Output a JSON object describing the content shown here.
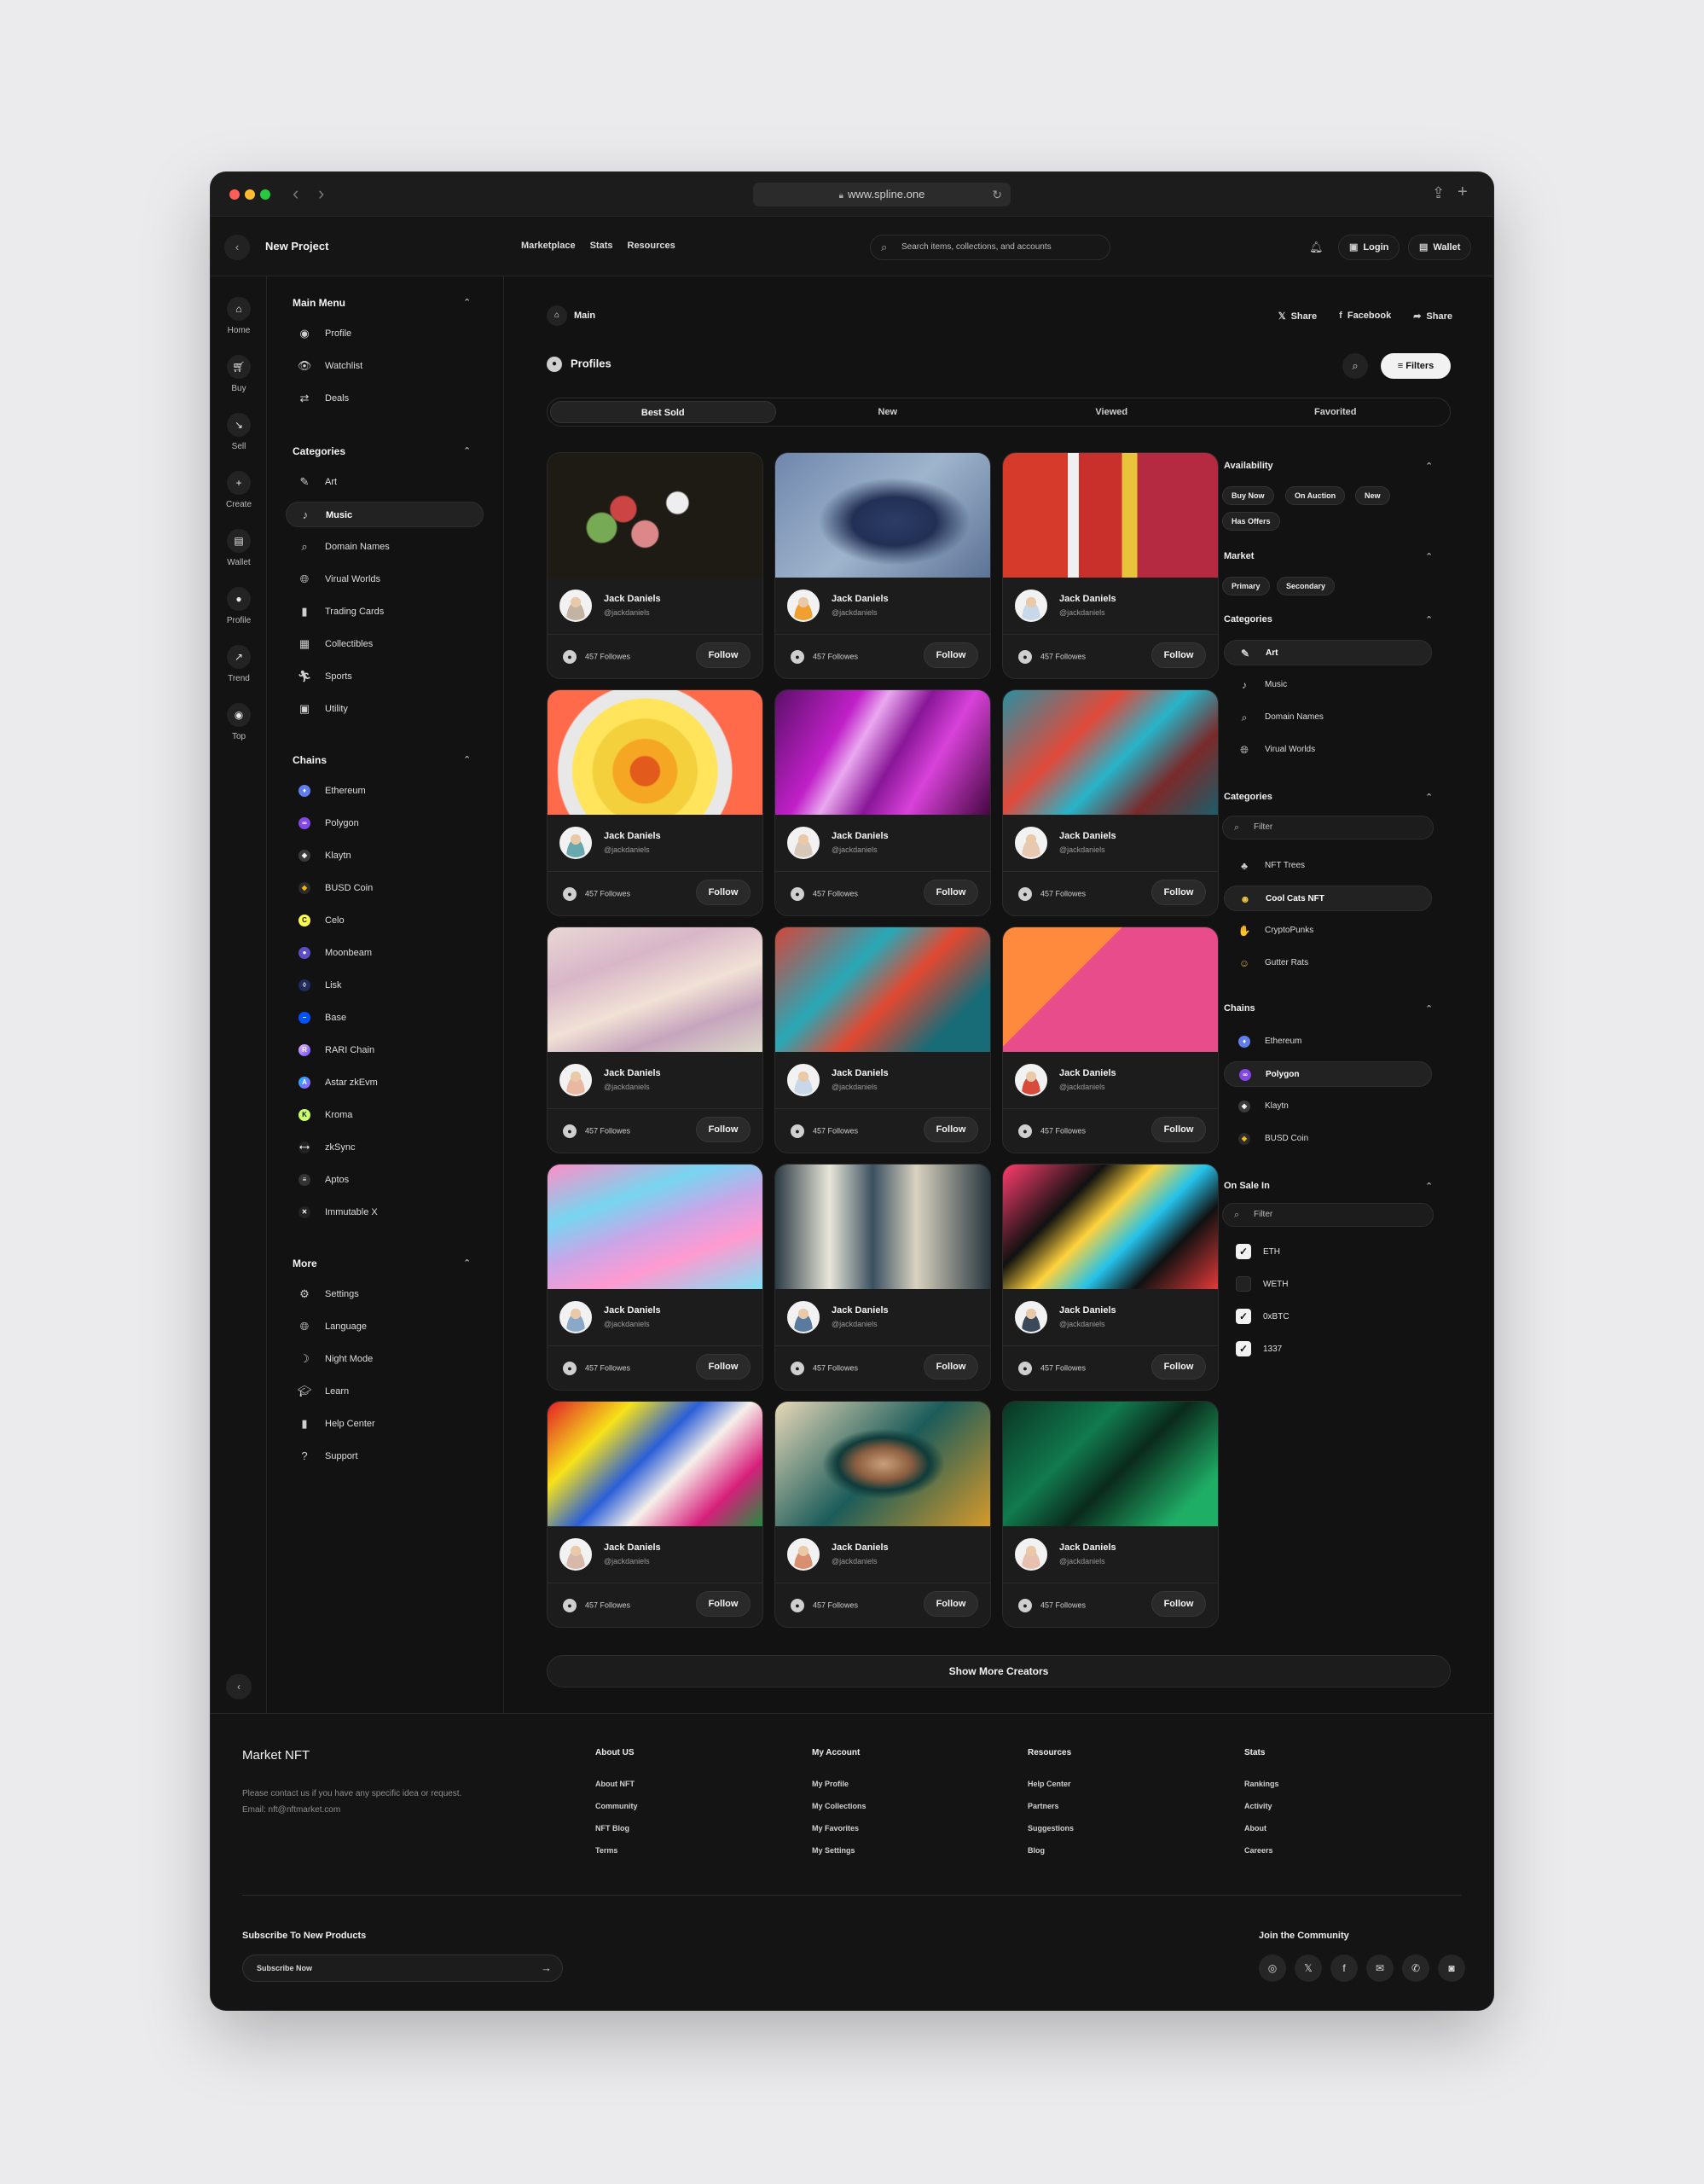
{
  "browser": {
    "url": "www.spline.one"
  },
  "header": {
    "title": "New Project",
    "nav": [
      "Marketplace",
      "Stats",
      "Resources"
    ],
    "search_placeholder": "Search items, collections, and accounts",
    "login_label": "Login",
    "wallet_label": "Wallet"
  },
  "rail": [
    {
      "label": "Home",
      "icon": "home-icon"
    },
    {
      "label": "Buy",
      "icon": "cart-icon"
    },
    {
      "label": "Sell",
      "icon": "trend-down-icon"
    },
    {
      "label": "Create",
      "icon": "plus-icon"
    },
    {
      "label": "Wallet",
      "icon": "wallet-icon"
    },
    {
      "label": "Profile",
      "icon": "user-icon"
    },
    {
      "label": "Trend",
      "icon": "trend-up-icon"
    },
    {
      "label": "Top",
      "icon": "target-icon"
    }
  ],
  "sidebar": {
    "main_menu": {
      "title": "Main Menu",
      "items": [
        "Profile",
        "Watchlist",
        "Deals"
      ]
    },
    "categories": {
      "title": "Categories",
      "items": [
        "Art",
        "Music",
        "Domain Names",
        "Virual Worlds",
        "Trading Cards",
        "Collectibles",
        "Sports",
        "Utility"
      ],
      "active": "Music"
    },
    "chains": {
      "title": "Chains",
      "items": [
        "Ethereum",
        "Polygon",
        "Klaytn",
        "BUSD Coin",
        "Celo",
        "Moonbeam",
        "Lisk",
        "Base",
        "RARI Chain",
        "Astar zkEvm",
        "Kroma",
        "zkSync",
        "Aptos",
        "Immutable X"
      ]
    },
    "more": {
      "title": "More",
      "items": [
        "Settings",
        "Language",
        "Night Mode",
        "Learn",
        "Help Center",
        "Support"
      ]
    }
  },
  "main": {
    "breadcrumb": "Main",
    "share_links": [
      "Share",
      "Facebook",
      "Share"
    ],
    "section_title": "Profiles",
    "filters_label": "Filters",
    "tabs": [
      "Best Sold",
      "New",
      "Viewed",
      "Favorited"
    ],
    "active_tab": "Best Sold",
    "cards": [
      {
        "name": "Jack Daniels",
        "handle": "@jackdaniels",
        "followers": "457 Followes",
        "follow": "Follow"
      },
      {
        "name": "Jack Daniels",
        "handle": "@jackdaniels",
        "followers": "457 Followes",
        "follow": "Follow"
      },
      {
        "name": "Jack Daniels",
        "handle": "@jackdaniels",
        "followers": "457 Followes",
        "follow": "Follow"
      },
      {
        "name": "Jack Daniels",
        "handle": "@jackdaniels",
        "followers": "457 Followes",
        "follow": "Follow"
      },
      {
        "name": "Jack Daniels",
        "handle": "@jackdaniels",
        "followers": "457 Followes",
        "follow": "Follow"
      },
      {
        "name": "Jack Daniels",
        "handle": "@jackdaniels",
        "followers": "457 Followes",
        "follow": "Follow"
      },
      {
        "name": "Jack Daniels",
        "handle": "@jackdaniels",
        "followers": "457 Followes",
        "follow": "Follow"
      },
      {
        "name": "Jack Daniels",
        "handle": "@jackdaniels",
        "followers": "457 Followes",
        "follow": "Follow"
      },
      {
        "name": "Jack Daniels",
        "handle": "@jackdaniels",
        "followers": "457 Followes",
        "follow": "Follow"
      },
      {
        "name": "Jack Daniels",
        "handle": "@jackdaniels",
        "followers": "457 Followes",
        "follow": "Follow"
      },
      {
        "name": "Jack Daniels",
        "handle": "@jackdaniels",
        "followers": "457 Followes",
        "follow": "Follow"
      },
      {
        "name": "Jack Daniels",
        "handle": "@jackdaniels",
        "followers": "457 Followes",
        "follow": "Follow"
      },
      {
        "name": "Jack Daniels",
        "handle": "@jackdaniels",
        "followers": "457 Followes",
        "follow": "Follow"
      },
      {
        "name": "Jack Daniels",
        "handle": "@jackdaniels",
        "followers": "457 Followes",
        "follow": "Follow"
      },
      {
        "name": "Jack Daniels",
        "handle": "@jackdaniels",
        "followers": "457 Followes",
        "follow": "Follow"
      }
    ],
    "show_more": "Show More Creators"
  },
  "filters": {
    "availability": {
      "title": "Availability",
      "chips": [
        "Buy Now",
        "On Auction",
        "New",
        "Has Offers"
      ]
    },
    "market": {
      "title": "Market",
      "chips": [
        "Primary",
        "Secondary"
      ]
    },
    "categories": {
      "title": "Categories",
      "items": [
        "Art",
        "Music",
        "Domain Names",
        "Virual Worlds"
      ],
      "active": "Art"
    },
    "collections": {
      "title": "Categories",
      "placeholder": "Filter",
      "items": [
        "NFT Trees",
        "Cool Cats NFT",
        "CryptoPunks",
        "Gutter Rats"
      ],
      "active": "Cool Cats NFT"
    },
    "chains": {
      "title": "Chains",
      "items": [
        "Ethereum",
        "Polygon",
        "Klaytn",
        "BUSD Coin"
      ],
      "active": "Polygon"
    },
    "on_sale": {
      "title": "On Sale In",
      "placeholder": "Filter",
      "items": [
        {
          "label": "ETH",
          "checked": true
        },
        {
          "label": "WETH",
          "checked": false
        },
        {
          "label": "0xBTC",
          "checked": true
        },
        {
          "label": "1337",
          "checked": true
        }
      ]
    }
  },
  "footer": {
    "brand": "Market NFT",
    "desc_line1": "Please contact us if you have any specific idea or request.",
    "desc_line2": "Email: nft@nftmarket.com",
    "columns": [
      {
        "title": "About US",
        "links": [
          "About NFT",
          "Community",
          "NFT Blog",
          "Terms"
        ]
      },
      {
        "title": "My Account",
        "links": [
          "My Profile",
          "My Collections",
          "My Favorites",
          "My Settings"
        ]
      },
      {
        "title": "Resources",
        "links": [
          "Help Center",
          "Partners",
          "Suggestions",
          "Blog"
        ]
      },
      {
        "title": "Stats",
        "links": [
          "Rankings",
          "Activity",
          "About",
          "Careers"
        ]
      }
    ],
    "subscribe_title": "Subscribe To New Products",
    "subscribe_placeholder": "Subscribe Now",
    "join_title": "Join the Community",
    "socials": [
      "instagram-icon",
      "x-icon",
      "facebook-icon",
      "mail-icon",
      "whatsapp-icon",
      "discord-icon"
    ]
  },
  "colors": {
    "background": "#121212",
    "surface": "#1c1c1c",
    "accent": "#f2f2f2",
    "page": "#ebebed"
  }
}
